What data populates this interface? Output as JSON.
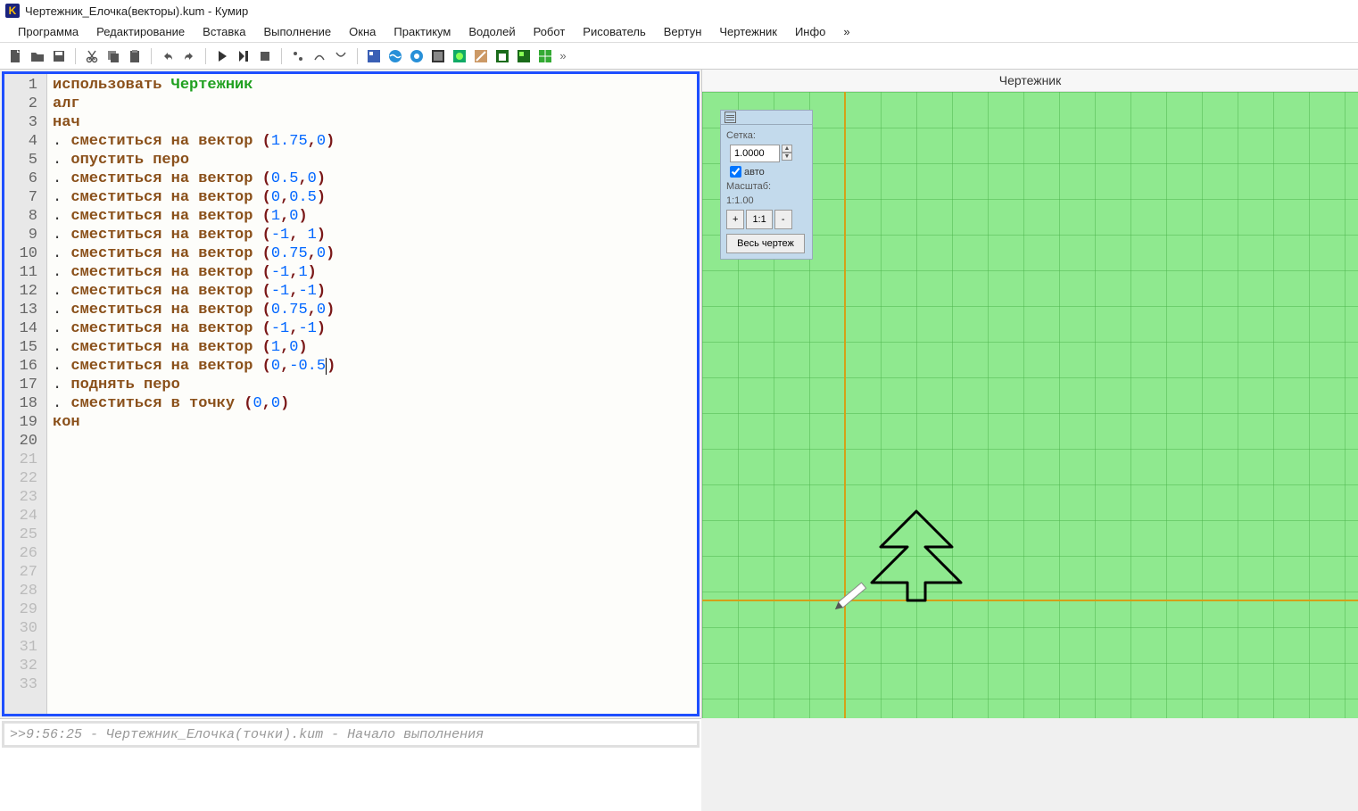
{
  "title": "Чертежник_Елочка(векторы).kum - Кумир",
  "menu": [
    "Программа",
    "Редактирование",
    "Вставка",
    "Выполнение",
    "Окна",
    "Практикум",
    "Водолей",
    "Робот",
    "Рисователь",
    "Вертун",
    "Чертежник",
    "Инфо",
    "»"
  ],
  "right_title": "Чертежник",
  "panel": {
    "grid_label": "Сетка:",
    "grid_value": "1.0000",
    "auto": "авто",
    "scale_label": "Масштаб:",
    "scale_value": "1:1.00",
    "plus": "+",
    "oneone": "1:1",
    "minus": "-",
    "fit": "Весь чертеж"
  },
  "console_prefix": ">> ",
  "console_text": "9:56:25 - Чертежник_Елочка(точки).kum - Начало выполнения",
  "code": {
    "lines": 33,
    "l1_use": "использовать",
    "l1_mod": "Чертежник",
    "l2": "алг",
    "l3": "нач",
    "cmd_vec": "сместиться на вектор",
    "cmd_down": "опустить перо",
    "cmd_up": "поднять перо",
    "cmd_point": "сместиться в точку",
    "l19": "кон",
    "v4a": "1.75",
    "v4b": "0",
    "v6a": "0.5",
    "v6b": "0",
    "v7a": "0",
    "v7b": "0.5",
    "v8a": "1",
    "v8b": "0",
    "v9a": "-1",
    "v9b": "1",
    "v10a": "0.75",
    "v10b": "0",
    "v11a": "-1",
    "v11b": "1",
    "v12a": "-1",
    "v12b": "-1",
    "v13a": "0.75",
    "v13b": "0",
    "v14a": "-1",
    "v14b": "-1",
    "v15a": "1",
    "v15b": "0",
    "v16a": "0",
    "v16b": "-0.5",
    "v18a": "0",
    "v18b": "0"
  }
}
